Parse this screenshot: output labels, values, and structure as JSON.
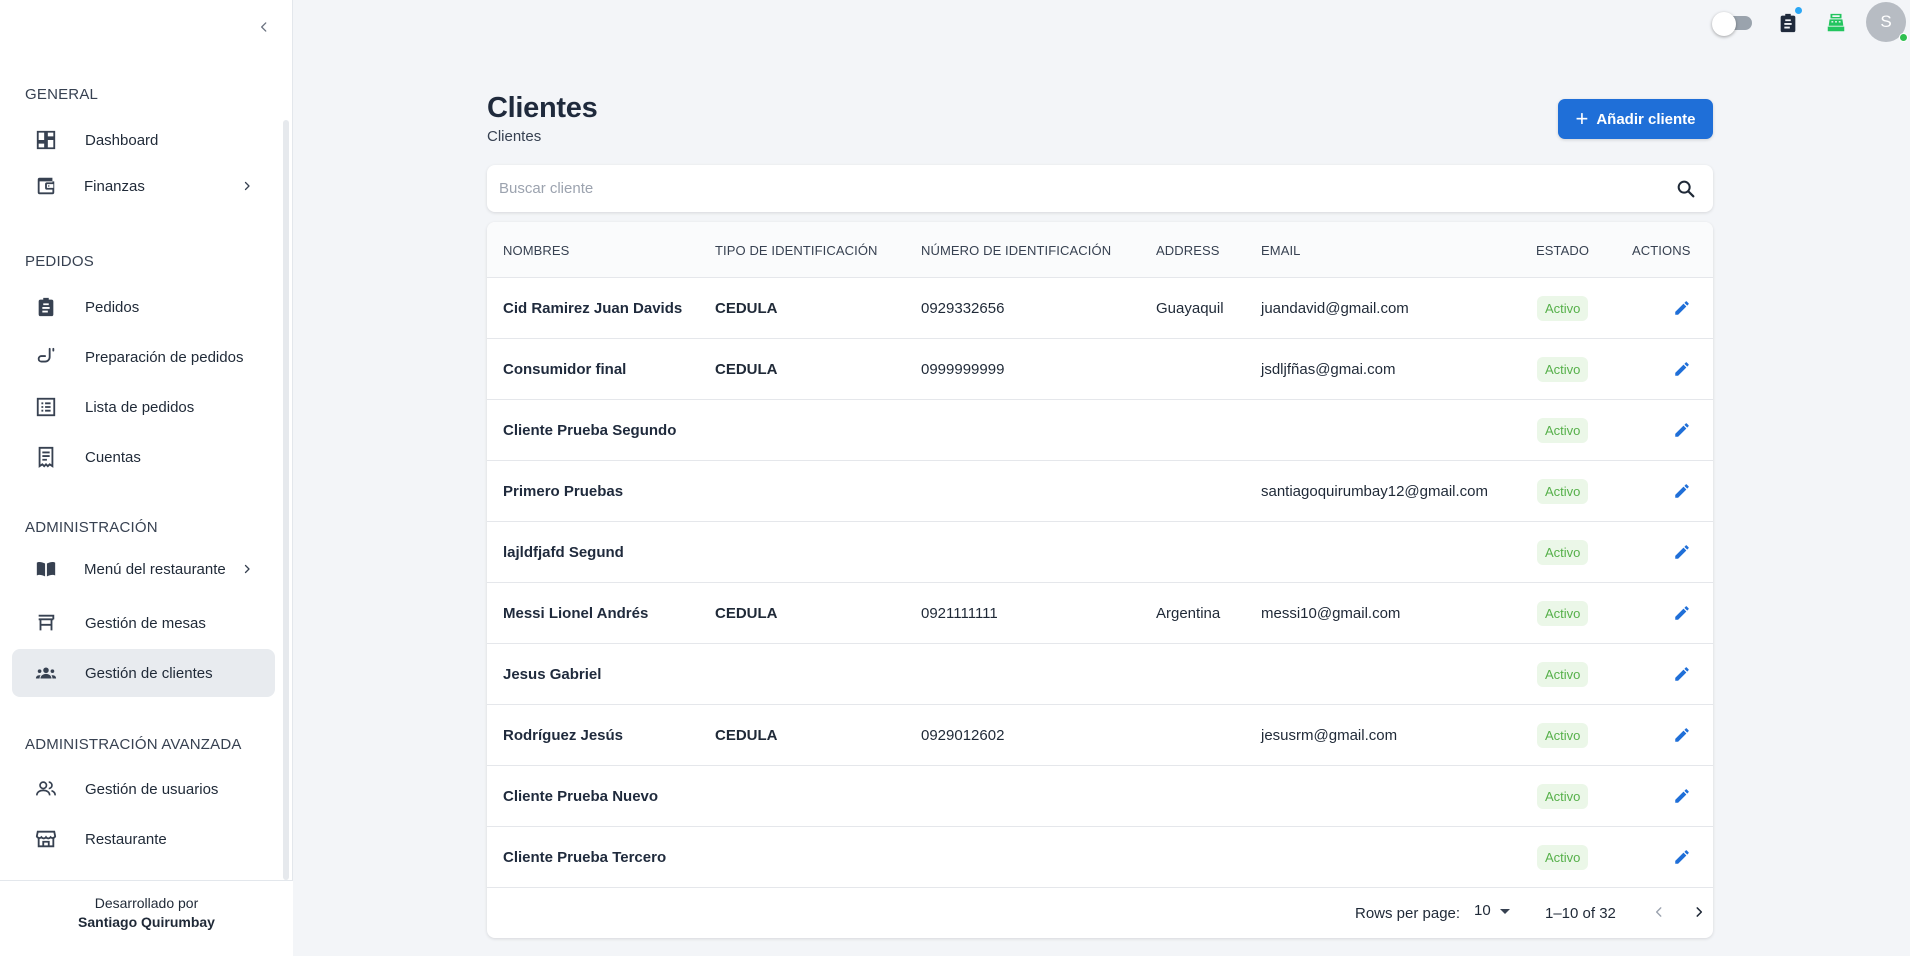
{
  "sidebar": {
    "sections": {
      "general": "GENERAL",
      "pedidos": "PEDIDOS",
      "administracion": "ADMINISTRACIÓN",
      "avanzada": "ADMINISTRACIÓN AVANZADA"
    },
    "items": {
      "dashboard": "Dashboard",
      "finanzas": "Finanzas",
      "pedidos": "Pedidos",
      "preparacion": "Preparación de pedidos",
      "lista": "Lista de pedidos",
      "cuentas": "Cuentas",
      "menu": "Menú del restaurante",
      "mesas": "Gestión de mesas",
      "clientes": "Gestión de clientes",
      "usuarios": "Gestión de usuarios",
      "restaurante": "Restaurante"
    },
    "active": "clientes",
    "footer": {
      "line1": "Desarrollado por",
      "line2": "Santiago Quirumbay"
    }
  },
  "topbar": {
    "avatar_initial": "S",
    "theme_toggle": "off"
  },
  "header": {
    "title": "Clientes",
    "subtitle": "Clientes",
    "add_button": "Añadir cliente"
  },
  "search": {
    "placeholder": "Buscar cliente",
    "value": ""
  },
  "table": {
    "columns": {
      "nombres": "NOMBRES",
      "tipo": "TIPO DE IDENTIFICACIÓN",
      "numero": "NÚMERO DE IDENTIFICACIÓN",
      "address": "ADDRESS",
      "email": "EMAIL",
      "estado": "ESTADO",
      "actions": "ACTIONS"
    },
    "rows": [
      {
        "nombre": "Cid Ramirez Juan Davids",
        "tipo": "CEDULA",
        "numero": "0929332656",
        "address": "Guayaquil",
        "email": "juandavid@gmail.com",
        "estado": "Activo"
      },
      {
        "nombre": "Consumidor final",
        "tipo": "CEDULA",
        "numero": "0999999999",
        "address": "",
        "email": "jsdljfñas@gmai.com",
        "estado": "Activo"
      },
      {
        "nombre": "Cliente Prueba Segundo",
        "tipo": "",
        "numero": "",
        "address": "",
        "email": "",
        "estado": "Activo"
      },
      {
        "nombre": "Primero Pruebas",
        "tipo": "",
        "numero": "",
        "address": "",
        "email": "santiagoquirumbay12@gmail.com",
        "estado": "Activo"
      },
      {
        "nombre": "lajldfjafd Segund",
        "tipo": "",
        "numero": "",
        "address": "",
        "email": "",
        "estado": "Activo"
      },
      {
        "nombre": "Messi Lionel Andrés",
        "tipo": "CEDULA",
        "numero": "0921111111",
        "address": "Argentina",
        "email": "messi10@gmail.com",
        "estado": "Activo"
      },
      {
        "nombre": "Jesus Gabriel",
        "tipo": "",
        "numero": "",
        "address": "",
        "email": "",
        "estado": "Activo"
      },
      {
        "nombre": "Rodríguez Jesús",
        "tipo": "CEDULA",
        "numero": "0929012602",
        "address": "",
        "email": "jesusrm@gmail.com",
        "estado": "Activo"
      },
      {
        "nombre": "Cliente Prueba Nuevo",
        "tipo": "",
        "numero": "",
        "address": "",
        "email": "",
        "estado": "Activo"
      },
      {
        "nombre": "Cliente Prueba Tercero",
        "tipo": "",
        "numero": "",
        "address": "",
        "email": "",
        "estado": "Activo"
      }
    ],
    "footer": {
      "rows_label": "Rows per page:",
      "rows_value": "10",
      "range": "1–10 of 32"
    }
  },
  "colors": {
    "primary": "#1f6fd8",
    "active_badge_bg": "#ebf7e8",
    "active_badge_text": "#56b04a",
    "accent_icon_green": "#22c55e"
  }
}
